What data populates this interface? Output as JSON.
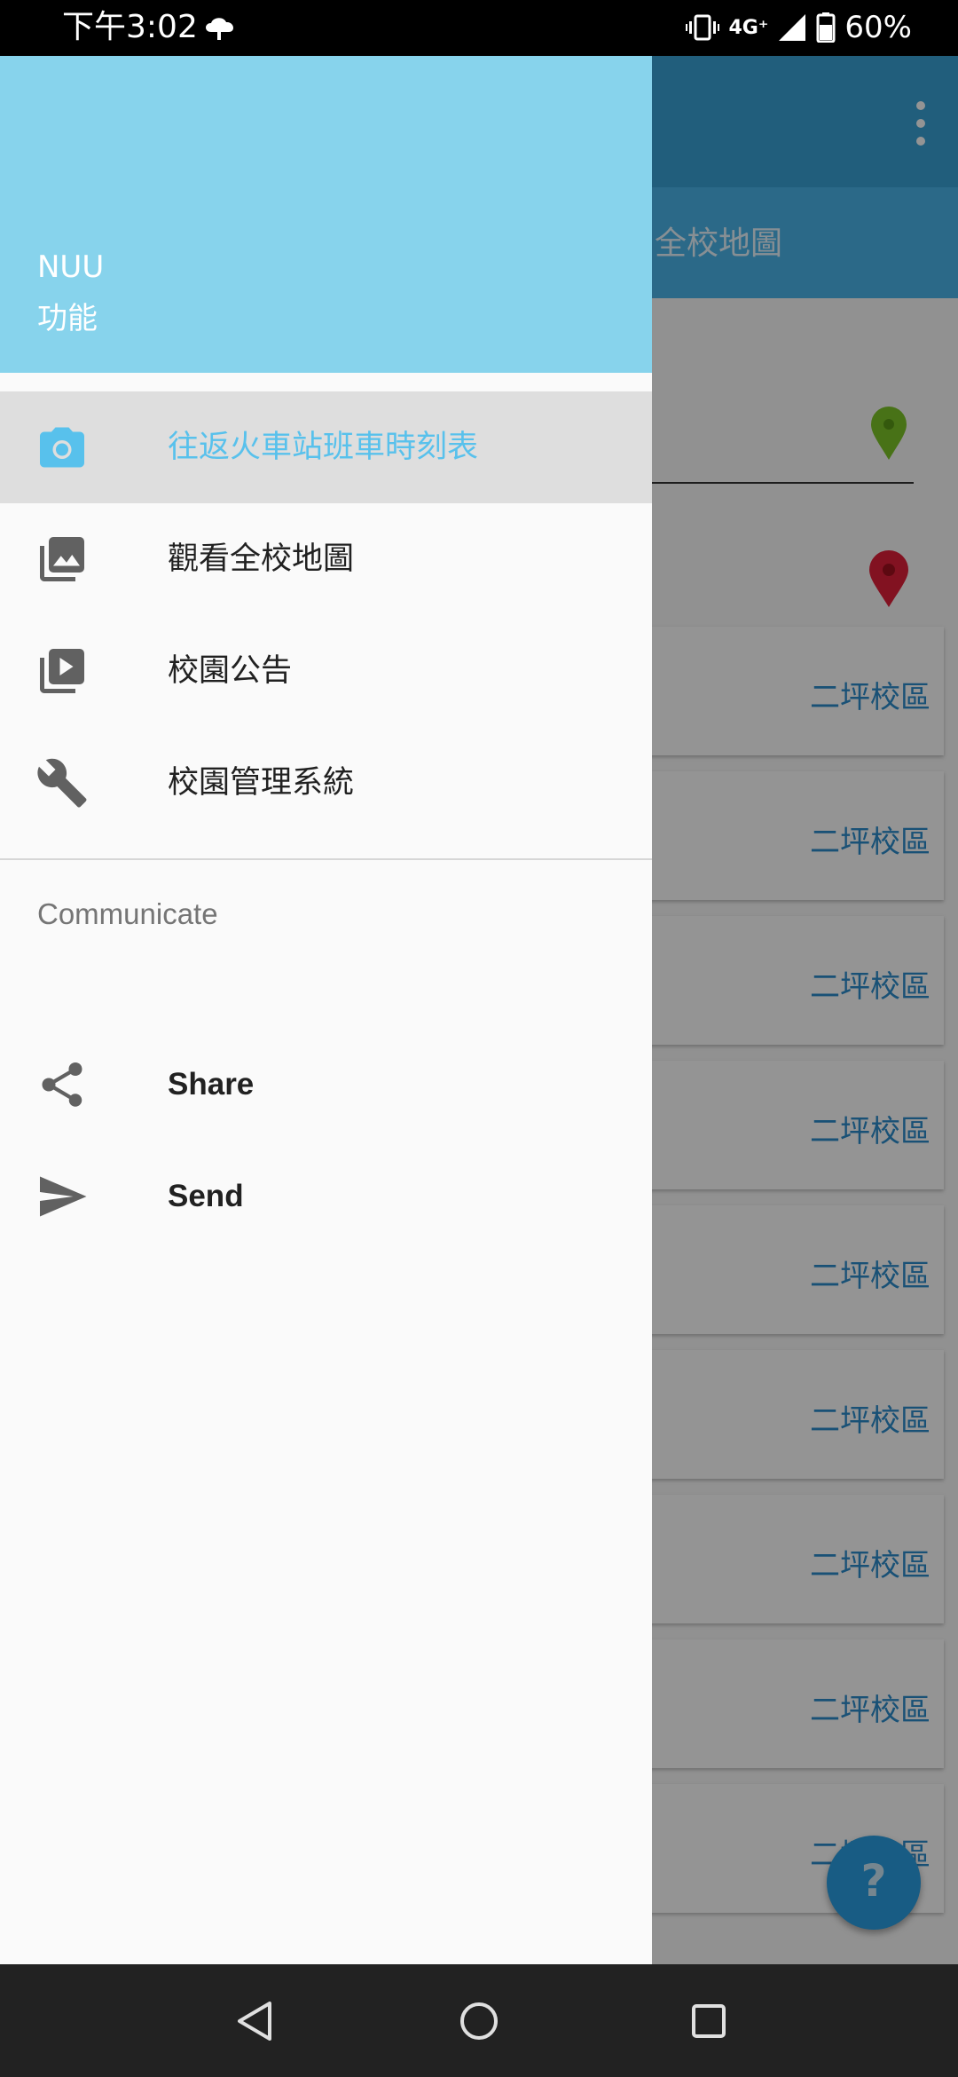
{
  "status_bar": {
    "time": "下午3:02",
    "network": "4G⁺",
    "battery": "60%"
  },
  "background_app": {
    "tab_label": "全校地圖",
    "card_labels": [
      "二坪校區",
      "二坪校區",
      "二坪校區",
      "二坪校區",
      "二坪校區",
      "二坪校區",
      "二坪校區",
      "二坪校區",
      "二坪校區"
    ],
    "fab_label": "?"
  },
  "drawer": {
    "header_title": "NUU",
    "header_subtitle": "功能",
    "items": [
      {
        "label": "往返火車站班車時刻表",
        "icon": "camera-icon",
        "selected": true
      },
      {
        "label": "觀看全校地圖",
        "icon": "gallery-icon",
        "selected": false
      },
      {
        "label": "校園公告",
        "icon": "slideshow-icon",
        "selected": false
      },
      {
        "label": "校園管理系統",
        "icon": "wrench-icon",
        "selected": false
      }
    ],
    "section_title": "Communicate",
    "comm_items": [
      {
        "label": "Share",
        "icon": "share-icon"
      },
      {
        "label": "Send",
        "icon": "send-icon"
      }
    ]
  },
  "colors": {
    "accent": "#58c1ec",
    "header": "#87d3ec",
    "appbar": "#3aa3d6"
  }
}
